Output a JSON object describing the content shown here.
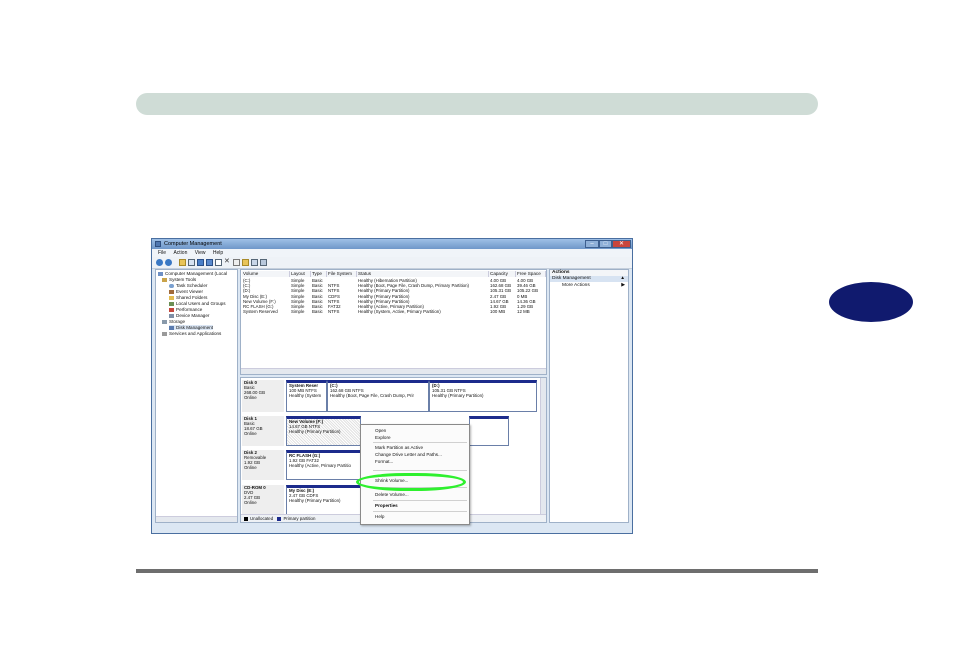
{
  "window": {
    "title": "Computer Management",
    "controls": [
      "–",
      "□",
      "✕"
    ],
    "accent": "#1c2b8c"
  },
  "menu": [
    "File",
    "Action",
    "View",
    "Help"
  ],
  "toolbar_icons": [
    "back-arrow-icon",
    "forward-arrow-icon",
    "up-folder-icon",
    "show-hide-tree-icon",
    "help-icon",
    "properties-icon",
    "export-icon",
    "delete-icon",
    "check-icon",
    "folder-icon",
    "search-icon",
    "settings-icon"
  ],
  "tree": [
    "Computer Management (Local",
    "System Tools",
    "Task Scheduler",
    "Event Viewer",
    "Shared Folders",
    "Local Users and Groups",
    "Performance",
    "Device Manager",
    "Storage",
    "Disk Management",
    "Services and Applications"
  ],
  "volumes": {
    "columns": [
      "Volume",
      "Layout",
      "Type",
      "File System",
      "Status",
      "Capacity",
      "Free Space"
    ],
    "rows": [
      [
        "(C:)",
        "Simple",
        "Basic",
        "",
        "Healthy (Hibernation Partition)",
        "4.00 GB",
        "4.00 GB"
      ],
      [
        "(C:)",
        "Simple",
        "Basic",
        "NTFS",
        "Healthy (Boot, Page File, Crash Dump, Primary Partition)",
        "162.68 GB",
        "39.46 GB"
      ],
      [
        "(D:)",
        "Simple",
        "Basic",
        "NTFS",
        "Healthy (Primary Partition)",
        "105.31 GB",
        "105.22 GB"
      ],
      [
        "My Disc (E:)",
        "Simple",
        "Basic",
        "CDFS",
        "Healthy (Primary Partition)",
        "2.47 GB",
        "0 MB"
      ],
      [
        "New Volume (F:)",
        "Simple",
        "Basic",
        "NTFS",
        "Healthy (Primary Partition)",
        "14.67 GB",
        "14.36 GB"
      ],
      [
        "RC FLASH (G:)",
        "Simple",
        "Basic",
        "FAT32",
        "Healthy (Active, Primary Partition)",
        "1.92 GB",
        "1.29 GB"
      ],
      [
        "System Reserved",
        "Simple",
        "Basic",
        "NTFS",
        "Healthy (System, Active, Primary Partition)",
        "100 MB",
        "12 MB"
      ]
    ]
  },
  "disks": [
    {
      "label": [
        "Disk 0",
        "Basic",
        "268.00 GB",
        "Online"
      ],
      "partitions": [
        [
          "System Reser",
          "100 MB NTFS",
          "Healthy (System"
        ],
        [
          "(C:)",
          "162.68 GB NTFS",
          "Healthy (Boot, Page File, Crash Dump, Prir"
        ],
        [
          "(D:)",
          "105.31 GB NTFS",
          "Healthy (Primary Partition)"
        ]
      ]
    },
    {
      "label": [
        "Disk 1",
        "Basic",
        "18.67 GB",
        "Online"
      ],
      "partitions": [
        [
          "New Volume (F:)",
          "14.67 GB NTFS",
          "Healthy (Primary Partition)"
        ]
      ]
    },
    {
      "label": [
        "Disk 2",
        "Removable",
        "1.92 GB",
        "Online"
      ],
      "partitions": [
        [
          "RC FLASH (G:)",
          "1.92 GB FAT32",
          "Healthy (Active, Primary Partitio"
        ]
      ]
    },
    {
      "label": [
        "CD-ROM 0",
        "DVD",
        "2.47 GB",
        "Online"
      ],
      "partitions": [
        [
          "My Disc (E:)",
          "2.47 GB CDFS",
          "Healthy (Primary Partition)"
        ]
      ]
    }
  ],
  "legend": [
    "Unallocated",
    "Primary partition"
  ],
  "actions": {
    "header": "Actions",
    "section": "Disk Management",
    "more": "More Actions"
  },
  "context_menu": [
    "Open",
    "Explore",
    "Mark Partition as Active",
    "Change Drive Letter and Paths...",
    "Format...",
    "Shrink Volume...",
    "Delete Volume...",
    "Properties",
    "Help"
  ]
}
